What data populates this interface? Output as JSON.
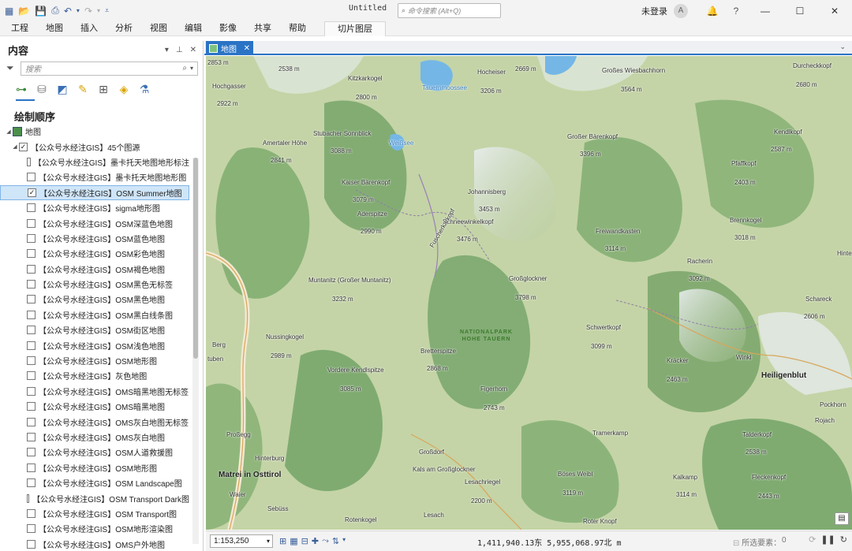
{
  "titlebar": {
    "title": "Untitled",
    "command_search_placeholder": "命令搜索 (Alt+Q)",
    "login": "未登录",
    "help": "?"
  },
  "ribbon": {
    "tabs": [
      "工程",
      "地图",
      "插入",
      "分析",
      "视图",
      "编辑",
      "影像",
      "共享",
      "帮助"
    ],
    "context_tab": "切片图层"
  },
  "contents": {
    "title": "内容",
    "search_placeholder": "搜索",
    "section_title": "绘制顺序",
    "map_name": "地图",
    "group_name": "【公众号水经注GIS】45个图源",
    "layers": [
      {
        "name": "【公众号水经注GIS】墨卡托天地图地形标注",
        "checked": false
      },
      {
        "name": "【公众号水经注GIS】墨卡托天地图地形图",
        "checked": false
      },
      {
        "name": "【公众号水经注GIS】OSM Summer地图",
        "checked": true,
        "selected": true
      },
      {
        "name": "【公众号水经注GIS】sigma地形图",
        "checked": false
      },
      {
        "name": "【公众号水经注GIS】OSM深蓝色地图",
        "checked": false
      },
      {
        "name": "【公众号水经注GIS】OSM蓝色地图",
        "checked": false
      },
      {
        "name": "【公众号水经注GIS】OSM彩色地图",
        "checked": false
      },
      {
        "name": "【公众号水经注GIS】OSM褐色地图",
        "checked": false
      },
      {
        "name": "【公众号水经注GIS】OSM黑色无标签",
        "checked": false
      },
      {
        "name": "【公众号水经注GIS】OSM黑色地图",
        "checked": false
      },
      {
        "name": "【公众号水经注GIS】OSM黑白线条图",
        "checked": false
      },
      {
        "name": "【公众号水经注GIS】OSM街区地图",
        "checked": false
      },
      {
        "name": "【公众号水经注GIS】OSM浅色地图",
        "checked": false
      },
      {
        "name": "【公众号水经注GIS】OSM地形图",
        "checked": false
      },
      {
        "name": "【公众号水经注GIS】灰色地图",
        "checked": false
      },
      {
        "name": "【公众号水经注GIS】OMS暗黑地图无标签",
        "checked": false
      },
      {
        "name": "【公众号水经注GIS】OMS暗黑地图",
        "checked": false
      },
      {
        "name": "【公众号水经注GIS】OMS灰白地图无标签",
        "checked": false
      },
      {
        "name": "【公众号水经注GIS】OMS灰白地图",
        "checked": false
      },
      {
        "name": "【公众号水经注GIS】OSM人道救援图",
        "checked": false
      },
      {
        "name": "【公众号水经注GIS】OSM地形图",
        "checked": false
      },
      {
        "name": "【公众号水经注GIS】OSM Landscape图",
        "checked": false
      },
      {
        "name": "【公众号水经注GIS】OSM Transport Dark图",
        "checked": false
      },
      {
        "name": "【公众号水经注GIS】OSM Transport图",
        "checked": false
      },
      {
        "name": "【公众号水经注GIS】OSM地形渲染图",
        "checked": false
      },
      {
        "name": "【公众号水经注GIS】OMS户外地图",
        "checked": false
      }
    ]
  },
  "map_tab": {
    "label": "地图"
  },
  "map_labels": {
    "l01": "2853 m",
    "l02": "2538 m",
    "l03": "Hochgasser",
    "l04": "2922 m",
    "l05": "Kitzkarkogel",
    "l06": "2800 m",
    "l07": "Tauernmoossee",
    "l08": "Hocheiser",
    "l09": "3206 m",
    "l10": "2669 m",
    "l11": "Großes Wiesbachhorn",
    "l12": "3564 m",
    "l13": "Durcheckkopf",
    "l14": "2680 m",
    "l15": "Amertaler Höhe",
    "l16": "2841 m",
    "l17": "Stubacher Sonnblick",
    "l18": "3088 m",
    "l19": "Weißsee",
    "l20": "Großer Bärenkopf",
    "l21": "3396 m",
    "l22": "Kendlkopf",
    "l23": "2587 m",
    "l24": "Kaiser Bärenkopf",
    "l25": "3079 m",
    "l26": "Johannisberg",
    "l27": "3453 m",
    "l28": "Pfaffkopf",
    "l29": "2403 m",
    "l30": "Aderspitze",
    "l31": "2990 m",
    "l32": "Schneewinkelkopf",
    "l33": "3476 m",
    "l34": "Brennkogel",
    "l35": "3018 m",
    "l36": "Fuscherkarkopf",
    "l37": "Freiwandkasten",
    "l38": "3114 m",
    "l39": "Racherin",
    "l40": "3092 m",
    "l41": "Muntanitz (Großer Muntanitz)",
    "l42": "3232 m",
    "l43": "Großglockner",
    "l44": "3798 m",
    "l45": "Schareck",
    "l46": "2606 m",
    "l47": "Hinte",
    "l48": "Nussingkogel",
    "l49": "2989 m",
    "l50": "Schwertkopf",
    "l51": "3099 m",
    "l52": "Bretterspitze",
    "l53": "2868 m",
    "l54": "Kräcker",
    "l55": "2463 m",
    "l56": "Winkl",
    "l57": "Vordere Kendlspitze",
    "l58": "3085 m",
    "l59": "Figerhorn",
    "l60": "2743 m",
    "l61": "Pockhorn",
    "l62": "Rojach",
    "l63": "Tramerkamp",
    "l64": "Talderkopf",
    "l65": "2538 m",
    "l66": "Großdorf",
    "l67": "Kals am Großglockner",
    "l68": "Böses Weibl",
    "l69": "3119 m",
    "l70": "Kalkamp",
    "l71": "3114 m",
    "l72": "Fleckenkopf",
    "l73": "2443 m",
    "l74": "Lesachriegel",
    "l75": "2200 m",
    "l76": "Rotenkogel",
    "l77": "Lesach",
    "l78": "Roter Knopf",
    "l79": "Hinterburg",
    "l80": "Waier",
    "l81": "Sebüss",
    "l82": "Proßegg",
    "l83": "Berg",
    "l84": "tuben"
  },
  "map_towns": {
    "heiligenblut": "Heiligenblut",
    "matrei": "Matrei in Osttirol"
  },
  "map_park": {
    "line1": "NATIONALPARK",
    "line2": "HOHE TAUERN"
  },
  "status": {
    "scale": "1:153,250",
    "coordinates": "1,411,940.13东  5,955,068.97北 m",
    "selected_features_label": "所选要素：",
    "selected_features_count": "0"
  },
  "colors": {
    "accent": "#2a73c5",
    "selection_bg": "#cfe5f8",
    "map_base": "#c6d5a8",
    "forest": "#6ea064",
    "lake": "#74b7e6"
  }
}
